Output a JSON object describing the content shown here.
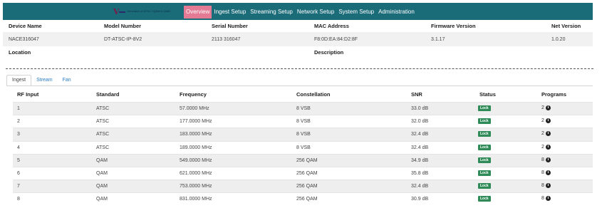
{
  "topnav": {
    "logo_text": "Generator of ATSC / QAM to QAM",
    "items": [
      {
        "label": "Overview",
        "active": true
      },
      {
        "label": "Ingest Setup",
        "active": false
      },
      {
        "label": "Streaming Setup",
        "active": false
      },
      {
        "label": "Network Setup",
        "active": false
      },
      {
        "label": "System Setup",
        "active": false
      },
      {
        "label": "Administration",
        "active": false
      }
    ]
  },
  "device": {
    "headers": {
      "device_name": "Device Name",
      "model_number": "Model Number",
      "serial_number": "Serial Number",
      "mac_address": "MAC Address",
      "firmware_version": "Firmware Version",
      "net_version": "Net Version",
      "location": "Location",
      "description": "Description"
    },
    "values": {
      "device_name": "NACE316047",
      "model_number": "DT-ATSC-IP-8V2",
      "serial_number": "2113 316047",
      "mac_address": "F8:0D:EA:84:D2:8F",
      "firmware_version": "3.1.17",
      "net_version": "1.0.20"
    }
  },
  "tabs": [
    {
      "label": "Ingest",
      "active": true
    },
    {
      "label": "Stream",
      "active": false
    },
    {
      "label": "Fan",
      "active": false
    }
  ],
  "table": {
    "columns": [
      "RF Input",
      "Standard",
      "Frequency",
      "Constellation",
      "SNR",
      "Status",
      "Programs"
    ],
    "rows": [
      {
        "rf": "1",
        "standard": "ATSC",
        "frequency": "57.0000 MHz",
        "constellation": "8 VSB",
        "snr": "33.0 dB",
        "status": "Lock",
        "programs": "2"
      },
      {
        "rf": "2",
        "standard": "ATSC",
        "frequency": "177.0000 MHz",
        "constellation": "8 VSB",
        "snr": "32.0 dB",
        "status": "Lock",
        "programs": "2"
      },
      {
        "rf": "3",
        "standard": "ATSC",
        "frequency": "183.0000 MHz",
        "constellation": "8 VSB",
        "snr": "32.4 dB",
        "status": "Lock",
        "programs": "2"
      },
      {
        "rf": "4",
        "standard": "ATSC",
        "frequency": "189.0000 MHz",
        "constellation": "8 VSB",
        "snr": "32.4 dB",
        "status": "Lock",
        "programs": "2"
      },
      {
        "rf": "5",
        "standard": "QAM",
        "frequency": "549.0000 MHz",
        "constellation": "256 QAM",
        "snr": "34.9 dB",
        "status": "Lock",
        "programs": "8"
      },
      {
        "rf": "6",
        "standard": "QAM",
        "frequency": "621.0000 MHz",
        "constellation": "256 QAM",
        "snr": "35.8 dB",
        "status": "Lock",
        "programs": "8"
      },
      {
        "rf": "7",
        "standard": "QAM",
        "frequency": "753.0000 MHz",
        "constellation": "256 QAM",
        "snr": "32.4 dB",
        "status": "Lock",
        "programs": "8"
      },
      {
        "rf": "8",
        "standard": "QAM",
        "frequency": "831.0000 MHz",
        "constellation": "256 QAM",
        "snr": "30.9 dB",
        "status": "Lock",
        "programs": "8"
      }
    ]
  },
  "colors": {
    "topbar": "#1b6c79",
    "nav_active": "#e47a93",
    "status_lock": "#2e8b57",
    "tab_link": "#2a7cc4"
  }
}
